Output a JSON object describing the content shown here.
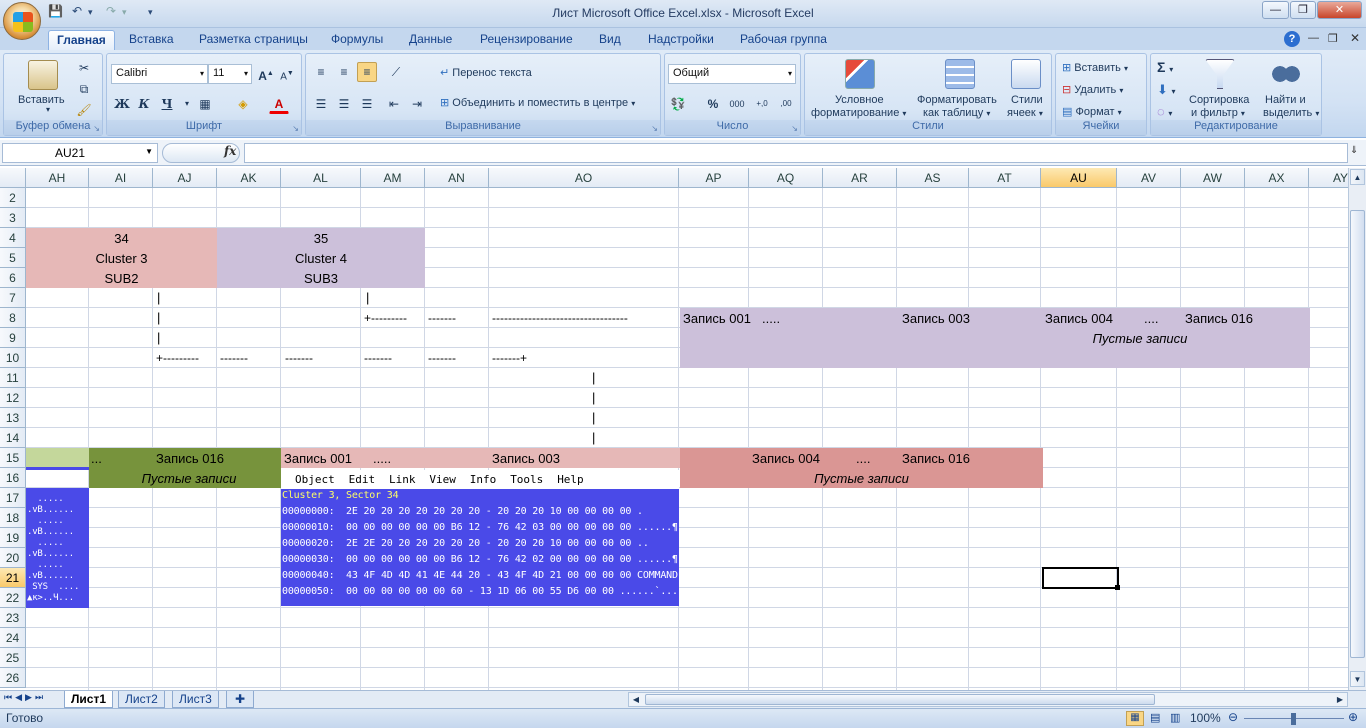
{
  "window": {
    "title": "Лист Microsoft Office Excel.xlsx - Microsoft Excel",
    "min_glyph": "—",
    "max_glyph": "❐",
    "close_glyph": "✕"
  },
  "qat": {
    "save_glyph": "💾",
    "undo_glyph": "↶",
    "redo_glyph": "↷",
    "more_glyph": "▾"
  },
  "tabs": [
    "Главная",
    "Вставка",
    "Разметка страницы",
    "Формулы",
    "Данные",
    "Рецензирование",
    "Вид",
    "Надстройки",
    "Рабочая группа"
  ],
  "ribbon": {
    "clipboard": {
      "label": "Буфер обмена",
      "paste": "Вставить"
    },
    "font": {
      "label": "Шрифт",
      "name": "Calibri",
      "size": "11",
      "grow": "A",
      "shrink": "A",
      "bold": "Ж",
      "italic": "К",
      "underline": "Ч",
      "color_letter": "А"
    },
    "alignment": {
      "label": "Выравнивание",
      "wrap": "Перенос текста",
      "merge": "Объединить и поместить в центре"
    },
    "number": {
      "label": "Число",
      "format": "Общий",
      "percent": "%",
      "thousands": "000",
      "inc": "+,0",
      "dec": ",00"
    },
    "styles": {
      "label": "Стили",
      "cond1": "Условное",
      "cond2": "форматирование",
      "table1": "Форматировать",
      "table2": "как таблицу",
      "cell1": "Стили",
      "cell2": "ячеек"
    },
    "cells": {
      "label": "Ячейки",
      "insert": "Вставить",
      "delete": "Удалить",
      "format": "Формат"
    },
    "editing": {
      "label": "Редактирование",
      "sort1": "Сортировка",
      "sort2": "и фильтр",
      "find1": "Найти и",
      "find2": "выделить",
      "sigma": "Σ"
    }
  },
  "formula_bar": {
    "name_box": "AU21",
    "fx": "fx",
    "formula": ""
  },
  "columns": [
    "AH",
    "AI",
    "AJ",
    "AK",
    "AL",
    "AM",
    "AN",
    "AO",
    "AP",
    "AQ",
    "AR",
    "AS",
    "AT",
    "AU",
    "AV",
    "AW",
    "AX",
    "AY"
  ],
  "rows": [
    "2",
    "3",
    "4",
    "5",
    "6",
    "7",
    "8",
    "9",
    "10",
    "11",
    "12",
    "13",
    "14",
    "15",
    "16",
    "17",
    "18",
    "19",
    "20",
    "21",
    "22",
    "23",
    "24",
    "25",
    "26"
  ],
  "selected": {
    "column": "AU",
    "row": "21"
  },
  "cells": {
    "r4_34": "34",
    "r5_cluster3": "Cluster 3",
    "r6_sub2": "SUB2",
    "r4_35": "35",
    "r5_cluster4": "Cluster 4",
    "r6_sub3": "SUB3",
    "pipe": "|",
    "r8_plus": "+---------",
    "r8_dash1": "-------",
    "r8_dash2": "----------------------------------",
    "r10_plus": "+---------",
    "r10_d1": "-------",
    "r10_d2": "-------",
    "r10_d3": "-------",
    "r10_d4": "-------",
    "r10_d5": "-------+",
    "r8_z001": "Запись 001",
    "r8_dots1": ".....",
    "r8_z003": "Запись 003",
    "r8_z004": "Запись 004",
    "r8_dots2": "....",
    "r8_z016": "Запись 016",
    "r9_empty": "Пустые записи",
    "r15_dots": "...",
    "r15_z016": "Запись 016",
    "r16_empty": "Пустые записи",
    "r15_z001": "Запись 001",
    "r15_dots2": ".....",
    "r15_z003": "Запись 003",
    "r15_z004b": "Запись 004",
    "r15_dots3": "....",
    "r15_z016b": "Запись 016",
    "r16_empty2": "Пустые записи"
  },
  "hex_menu": [
    "Object",
    "Edit",
    "Link",
    "View",
    "Info",
    "Tools",
    "Help"
  ],
  "hex_title": "Cluster 3, Sector 34",
  "hex_lines": [
    "00000000:  2E 20 20 20 20 20 20 20 - 20 20 20 10 00 00 00 00 .               .....",
    "00000010:  00 00 00 00 00 00 B6 12 - 76 42 03 00 00 00 00 00 ......¶.vB......",
    "00000020:  2E 2E 20 20 20 20 20 20 - 20 20 20 10 00 00 00 00 ..              .....",
    "00000030:  00 00 00 00 00 00 B6 12 - 76 42 02 00 00 00 00 00 ......¶.vB......",
    "00000040:  43 4F 4D 4D 41 4E 44 20 - 43 4F 4D 21 00 00 00 00 COMMAND COM!....",
    "00000050:  00 00 00 00 00 00 60 - 13 1D 06 00 55 D6 00 00 ......`....U..."
  ],
  "hex_left": [
    "  .....",
    ".vB......",
    "  .....",
    ".vB......",
    "  .....",
    ".vB......",
    "  .....",
    ".vB......",
    " SYS  ....",
    "▲к>..Ч..."
  ],
  "sheets": [
    "Лист1",
    "Лист2",
    "Лист3"
  ],
  "status": {
    "ready": "Готово",
    "zoom": "100%"
  },
  "colors": {
    "salmon": "#e6b8b7",
    "lavender": "#ccc0da",
    "olive": "#77933c",
    "lightolive": "#c4d79b",
    "pink": "#e6b8b7",
    "rose": "#da9694",
    "hexblue": "#4a4ae8"
  }
}
